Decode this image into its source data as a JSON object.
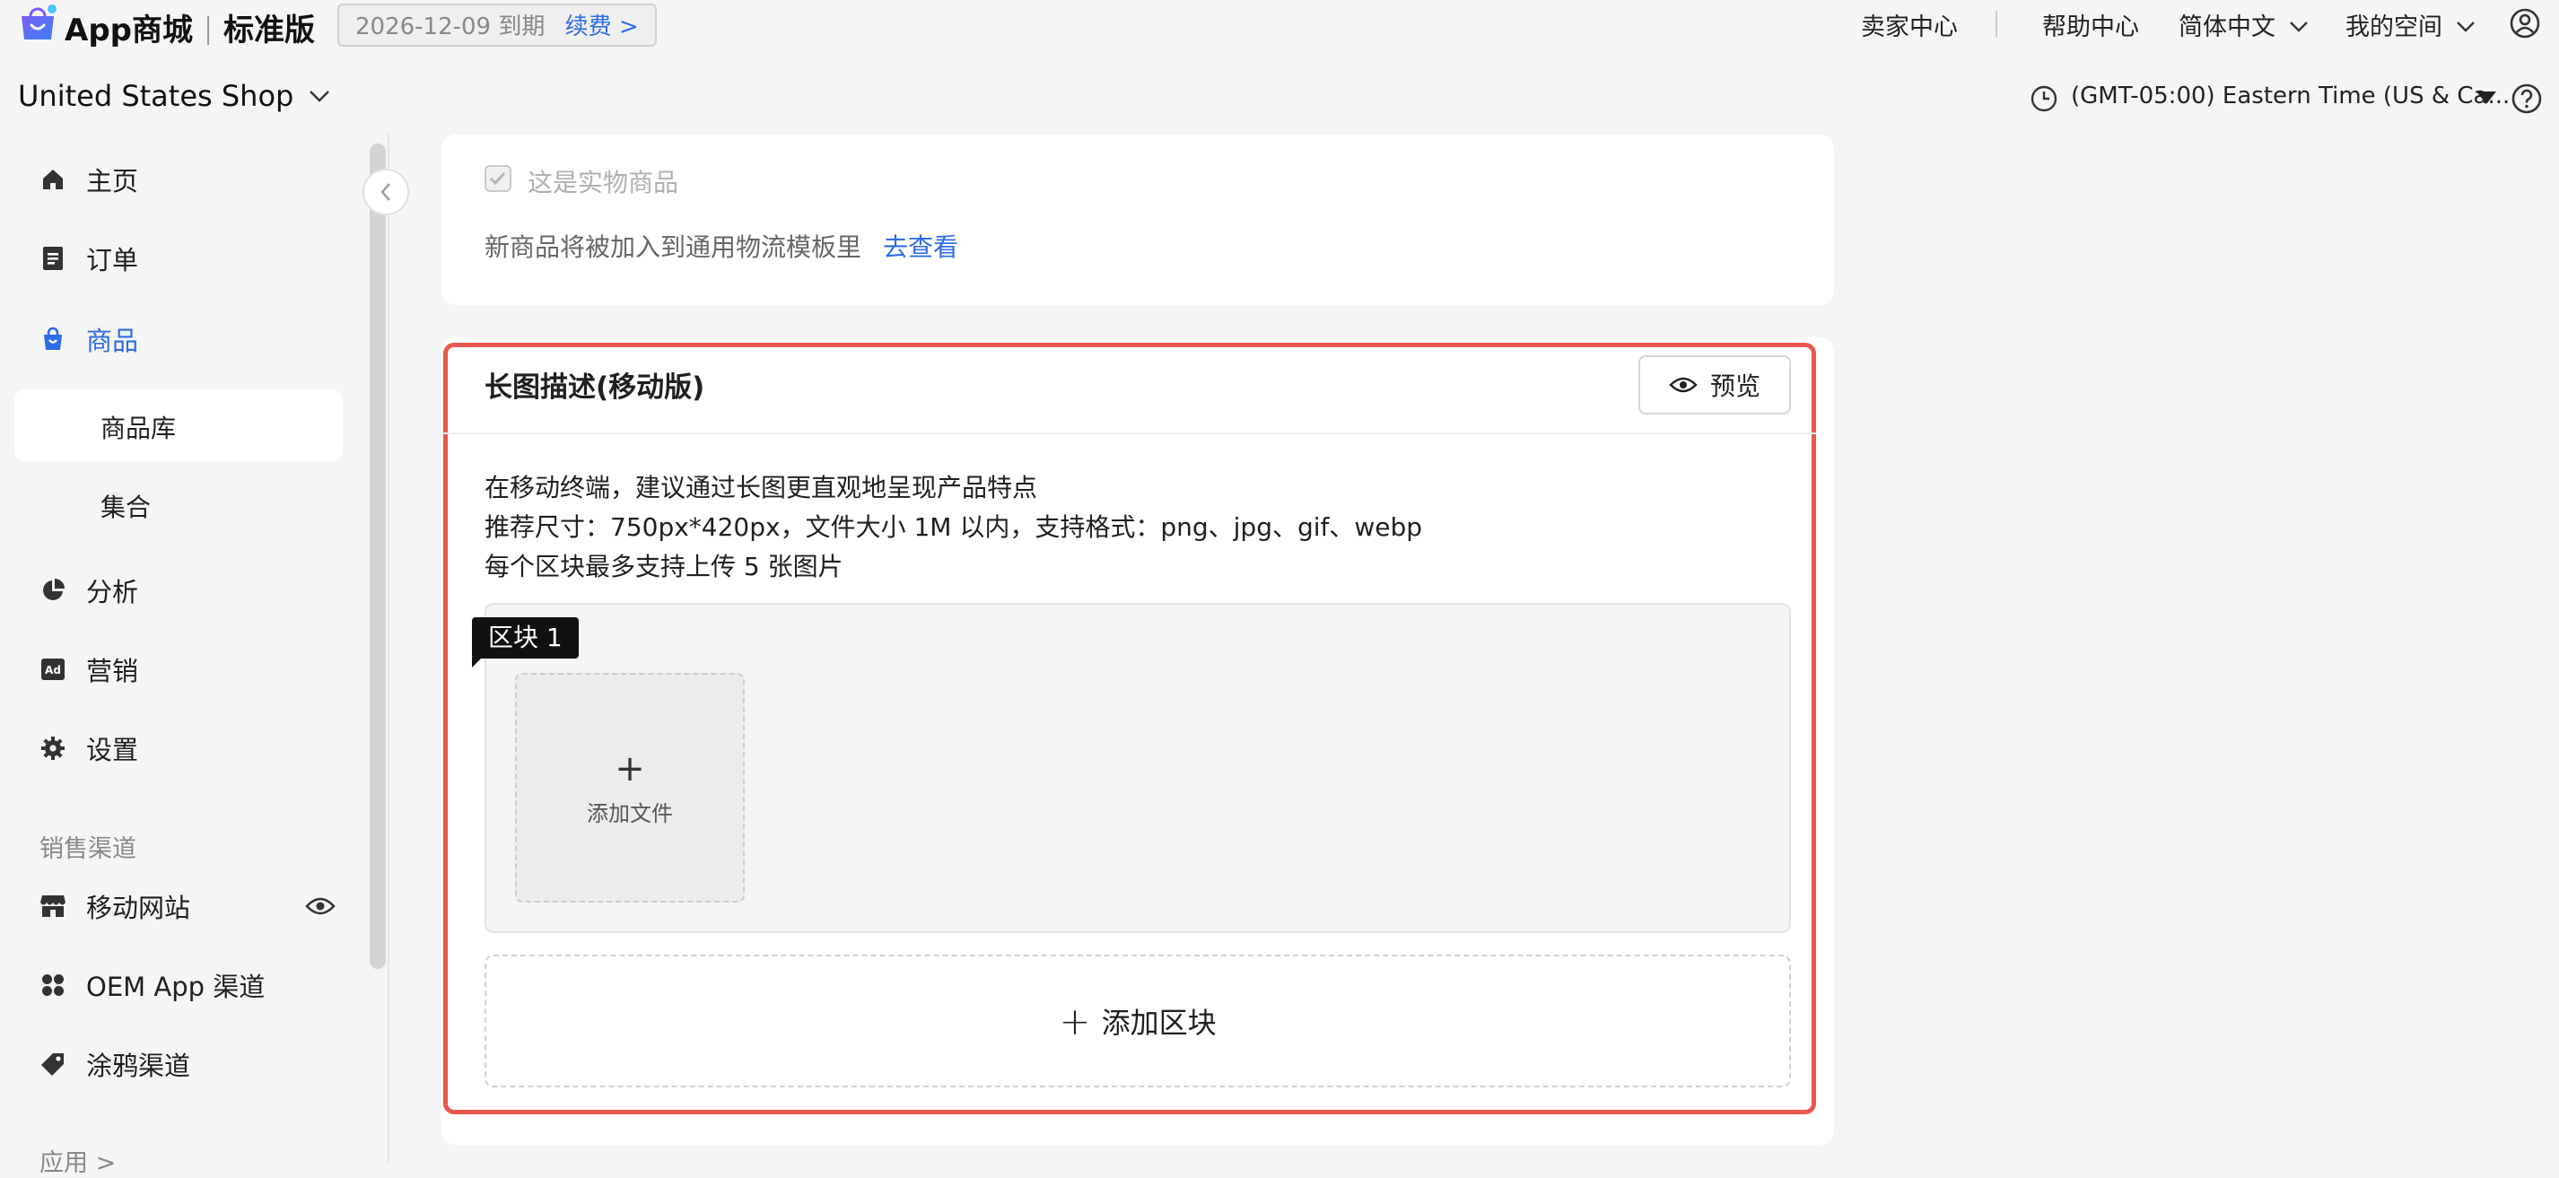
{
  "header": {
    "brand_name": "App商城",
    "edition": "标准版",
    "expiry_date": "2026-12-09 到期",
    "renew_label": "续费 >",
    "nav": {
      "seller_center": "卖家中心",
      "help_center": "帮助中心",
      "language": "简体中文",
      "my_space": "我的空间"
    },
    "shop_name": "United States Shop",
    "timezone": "(GMT-05:00) Eastern Time (US & Ca..."
  },
  "sidebar": {
    "items": [
      {
        "label": "主页",
        "icon": "home-icon"
      },
      {
        "label": "订单",
        "icon": "orders-icon"
      },
      {
        "label": "商品",
        "icon": "products-icon",
        "active": true
      },
      {
        "label": "分析",
        "icon": "analytics-icon"
      },
      {
        "label": "营销",
        "icon": "ad-icon"
      },
      {
        "label": "设置",
        "icon": "gear-icon"
      }
    ],
    "product_sub": [
      "商品库",
      "集合"
    ],
    "channels_label": "销售渠道",
    "channels": [
      {
        "label": "移动网站",
        "icon": "store-icon"
      },
      {
        "label": "OEM App 渠道",
        "icon": "apps-icon"
      },
      {
        "label": "涂鸦渠道",
        "icon": "tag-icon"
      }
    ],
    "apps_label": "应用 >"
  },
  "physical_card": {
    "checkbox_label": "这是实物商品",
    "logistics_text": "新商品将被加入到通用物流模板里",
    "logistics_link": "去查看"
  },
  "long_image_card": {
    "title": "长图描述(移动版)",
    "preview_label": "预览",
    "desc_lines": [
      "在移动终端，建议通过长图更直观地呈现产品特点",
      "推荐尺寸：750px*420px，文件大小 1M 以内，支持格式：png、jpg、gif、webp",
      "每个区块最多支持上传 5 张图片"
    ],
    "block_tag": "区块 1",
    "upload_plus": "+",
    "upload_label": "添加文件",
    "add_block_plus": "+",
    "add_block_label": "添加区块"
  },
  "colors": {
    "accent": "#2e6be6",
    "highlight_border": "#e8584e"
  }
}
